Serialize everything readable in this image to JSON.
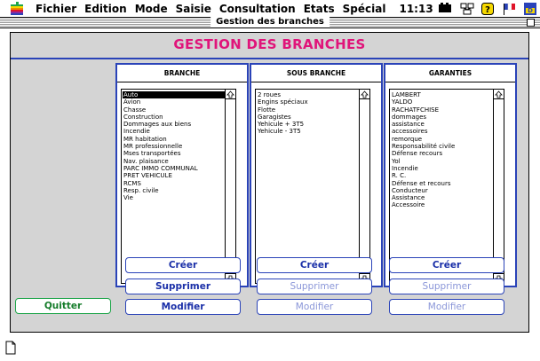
{
  "menubar": {
    "items": [
      "Fichier",
      "Edition",
      "Mode",
      "Saisie",
      "Consultation",
      "Etats",
      "Spécial"
    ],
    "clock": "11:13",
    "icons": [
      "apple-icon",
      "film-icon",
      "network-icon",
      "help-icon",
      "flag-icon",
      "app-icon"
    ]
  },
  "window": {
    "title": "Gestion des branches"
  },
  "header": {
    "title": "GESTION DES BRANCHES"
  },
  "panels": {
    "branche": {
      "title": "BRANCHE",
      "items": [
        "Auto",
        "Avion",
        "Chasse",
        "Construction",
        "Dommages aux biens",
        "Incendie",
        "MR habitation",
        "MR professionnelle",
        "Mses transportées",
        "Nav. plaisance",
        "PARC IMMO COMMUNAL",
        "PRET VEHICULE",
        "RCMS",
        "Resp. civile",
        "Vie"
      ],
      "selected": "Auto"
    },
    "sous_branche": {
      "title": "SOUS BRANCHE",
      "items": [
        "2 roues",
        "Engins spéciaux",
        "Flotte",
        "Garagistes",
        "Yehicule + 3T5",
        "Yehicule - 3T5"
      ]
    },
    "garanties": {
      "title": "GARANTIES",
      "items": [
        "LAMBERT",
        "YALDO",
        "RACHATFCHISE",
        "dommages",
        "assistance",
        "accessoires",
        "remorque",
        "Responsabilité civile",
        "Défense recours",
        "Yol",
        "Incendie",
        "R. C.",
        "Défense et recours",
        "Conducteur",
        "Assistance",
        "Accessoire"
      ]
    }
  },
  "buttons": {
    "creer": "Créer",
    "supprimer": "Supprimer",
    "modifier": "Modifier",
    "quitter": "Quitter"
  },
  "colors": {
    "accent_blue": "#2a43b8",
    "title_pink": "#e0147a",
    "quit_green": "#1fa54a"
  }
}
